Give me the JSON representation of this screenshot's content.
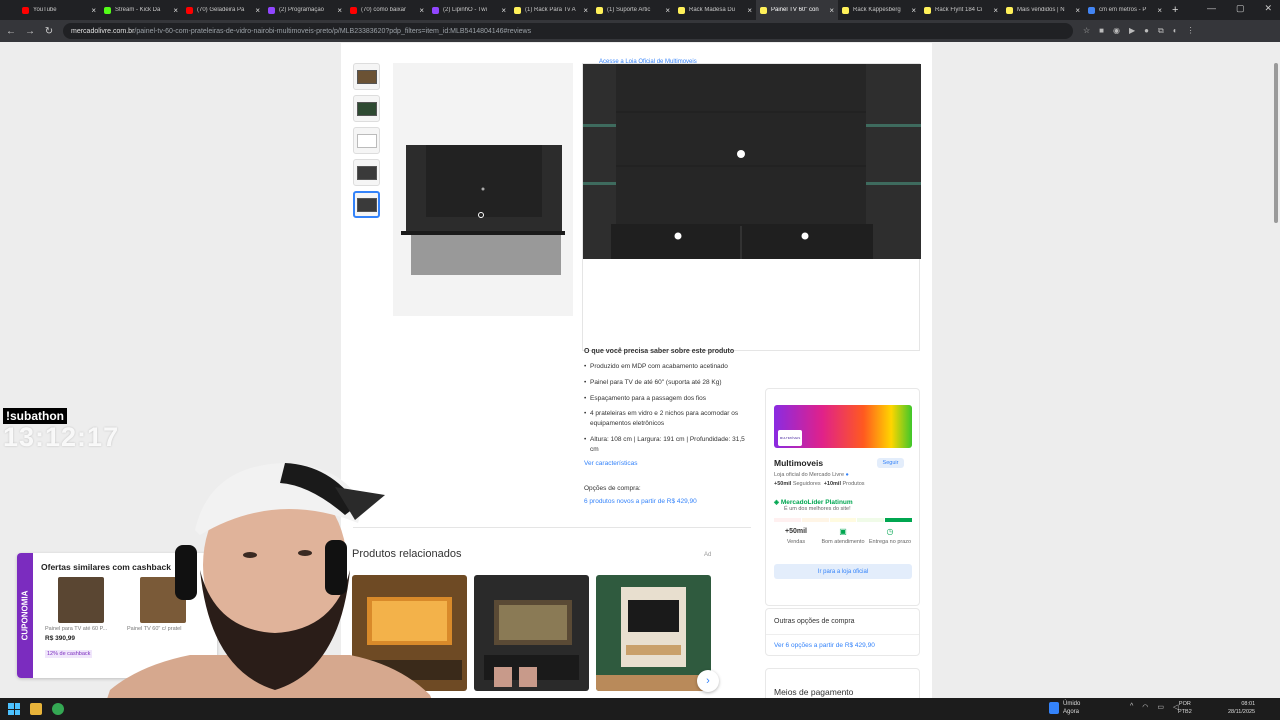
{
  "browser": {
    "tabs": [
      {
        "label": "YouTube",
        "color": "#ff0000",
        "active": false
      },
      {
        "label": "Stream - Kick Da",
        "color": "#53fc18",
        "active": false
      },
      {
        "label": "(70) Geladeira Pa",
        "color": "#ff0000",
        "active": false
      },
      {
        "label": "(2) Programação",
        "color": "#9146ff",
        "active": false
      },
      {
        "label": "(70) como baixar",
        "color": "#ff0000",
        "active": false
      },
      {
        "label": "(2) LipinhO - Twi",
        "color": "#9146ff",
        "active": false
      },
      {
        "label": "(1) Rack Para Tv A",
        "color": "#fff159",
        "active": false
      },
      {
        "label": "(1) Suporte Artic",
        "color": "#fff159",
        "active": false
      },
      {
        "label": "Rack Madesa Du",
        "color": "#fff159",
        "active": false
      },
      {
        "label": "Painel TV 60\" con",
        "color": "#fff159",
        "active": true
      },
      {
        "label": "Rack Kappesberg",
        "color": "#fff159",
        "active": false
      },
      {
        "label": "Rack Flynt 184 Ci",
        "color": "#fff159",
        "active": false
      },
      {
        "label": "Mais vendidos | N",
        "color": "#fff159",
        "active": false
      },
      {
        "label": "cm em metros - P",
        "color": "#4285f4",
        "active": false
      }
    ],
    "url_host": "mercadolivre.com.br",
    "url_path": "/painel-tv-60-com-prateleiras-de-vidro-nairobi-multimoveis-preto/p/MLB23383620?pdp_filters=item_id:MLB54148041​46#reviews"
  },
  "product": {
    "store_link": "Acesse a Loja Oficial de Multimoveis",
    "specs_title": "O que você precisa saber sobre este produto",
    "specs": [
      "Produzido em MDP com acabamento acetinado",
      "Painel para TV de até 60\" (suporta até 28 Kg)",
      "Espaçamento para a passagem dos fios",
      "4 prateleiras em vidro e 2 nichos para acomodar os equipamentos eletrônicos",
      "Altura: 108 cm | Largura: 191 cm | Profundidade: 31,5 cm"
    ],
    "see_features": "Ver características",
    "buy_options_label": "Opções de compra:",
    "buy_options_link": "6 produtos novos a partir de R$ 429,90"
  },
  "related": {
    "title": "Produtos relacionados",
    "more": "Ad"
  },
  "seller": {
    "name": "Multimoveis",
    "follow": "Seguir",
    "official": "Loja oficial do Mercado Livre",
    "followers": "+50mil",
    "followers_label": "Seguidores",
    "products": "+10mil",
    "products_label": "Produtos",
    "level": "MercadoLíder Platinum",
    "level_sub": "É um dos melhores do site!",
    "sales_value": "+50mil",
    "sales_label": "Vendas",
    "service_label": "Bom atendimento",
    "delivery_label": "Entrega no prazo",
    "store_button": "Ir para a loja oficial",
    "logo_text": "MULTIMÓVEIS"
  },
  "other_options": {
    "title": "Outras opções de compra",
    "link": "Ver 6 opções a partir de R$ 429,90"
  },
  "payment": {
    "title": "Meios de pagamento"
  },
  "overlay": {
    "subathon": "!subathon",
    "timer": "13:12:17",
    "cuponomia_side": "CUPONOMIA",
    "cuponomia_title": "Ofertas similares com cashback",
    "card1_name": "Painel para TV até 60 P...",
    "card1_price": "R$ 390,99",
    "card1_cashback": "12% de cashback",
    "card2_name": "Painel TV 60\" c/ pratel"
  },
  "taskbar": {
    "weather": "Úmido",
    "weather_sub": "Agora",
    "lang1": "POR",
    "lang2": "PTB2",
    "time": "08:01",
    "date": "28/11/2025"
  }
}
